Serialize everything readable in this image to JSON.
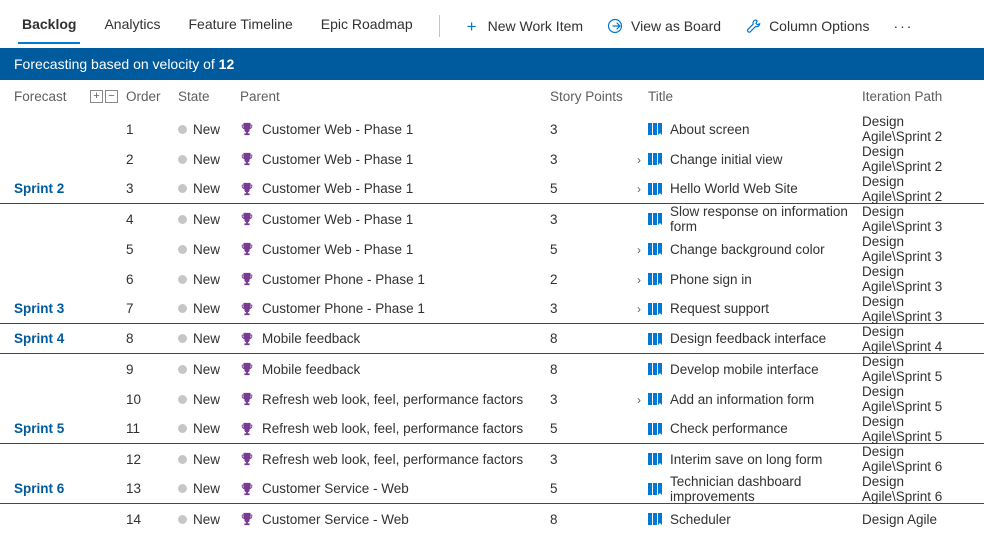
{
  "tabs": {
    "backlog": "Backlog",
    "analytics": "Analytics",
    "featureTimeline": "Feature Timeline",
    "epicRoadmap": "Epic Roadmap"
  },
  "commands": {
    "newWorkItem": "New Work Item",
    "viewAsBoard": "View as Board",
    "columnOptions": "Column Options"
  },
  "banner": {
    "prefix": "Forecasting based on velocity of ",
    "value": "12"
  },
  "headers": {
    "forecast": "Forecast",
    "order": "Order",
    "state": "State",
    "parent": "Parent",
    "storyPoints": "Story Points",
    "title": "Title",
    "iterationPath": "Iteration Path"
  },
  "rows": [
    {
      "forecast": "",
      "order": "1",
      "state": "New",
      "parent": "Customer Web - Phase 1",
      "points": "3",
      "expand": false,
      "title": "About screen",
      "iter": "Design Agile\\Sprint 2",
      "divider": false
    },
    {
      "forecast": "",
      "order": "2",
      "state": "New",
      "parent": "Customer Web - Phase 1",
      "points": "3",
      "expand": true,
      "title": "Change initial view",
      "iter": "Design Agile\\Sprint 2",
      "divider": false
    },
    {
      "forecast": "Sprint 2",
      "order": "3",
      "state": "New",
      "parent": "Customer Web - Phase 1",
      "points": "5",
      "expand": true,
      "title": "Hello World Web Site",
      "iter": "Design Agile\\Sprint 2",
      "divider": true
    },
    {
      "forecast": "",
      "order": "4",
      "state": "New",
      "parent": "Customer Web - Phase 1",
      "points": "3",
      "expand": false,
      "title": "Slow response on information form",
      "iter": "Design Agile\\Sprint 3",
      "divider": false
    },
    {
      "forecast": "",
      "order": "5",
      "state": "New",
      "parent": "Customer Web - Phase 1",
      "points": "5",
      "expand": true,
      "title": "Change background color",
      "iter": "Design Agile\\Sprint 3",
      "divider": false
    },
    {
      "forecast": "",
      "order": "6",
      "state": "New",
      "parent": "Customer Phone - Phase 1",
      "points": "2",
      "expand": true,
      "title": "Phone sign in",
      "iter": "Design Agile\\Sprint 3",
      "divider": false
    },
    {
      "forecast": "Sprint 3",
      "order": "7",
      "state": "New",
      "parent": "Customer Phone - Phase 1",
      "points": "3",
      "expand": true,
      "title": "Request support",
      "iter": "Design Agile\\Sprint 3",
      "divider": true
    },
    {
      "forecast": "Sprint 4",
      "order": "8",
      "state": "New",
      "parent": "Mobile feedback",
      "points": "8",
      "expand": false,
      "title": "Design feedback interface",
      "iter": "Design Agile\\Sprint 4",
      "divider": true
    },
    {
      "forecast": "",
      "order": "9",
      "state": "New",
      "parent": "Mobile feedback",
      "points": "8",
      "expand": false,
      "title": "Develop mobile interface",
      "iter": "Design Agile\\Sprint 5",
      "divider": false
    },
    {
      "forecast": "",
      "order": "10",
      "state": "New",
      "parent": "Refresh web look, feel, performance factors",
      "points": "3",
      "expand": true,
      "title": "Add an information form",
      "iter": "Design Agile\\Sprint 5",
      "divider": false
    },
    {
      "forecast": "Sprint 5",
      "order": "11",
      "state": "New",
      "parent": "Refresh web look, feel, performance factors",
      "points": "5",
      "expand": false,
      "title": "Check performance",
      "iter": "Design Agile\\Sprint 5",
      "divider": true
    },
    {
      "forecast": "",
      "order": "12",
      "state": "New",
      "parent": "Refresh web look, feel, performance factors",
      "points": "3",
      "expand": false,
      "title": "Interim save on long form",
      "iter": "Design Agile\\Sprint 6",
      "divider": false
    },
    {
      "forecast": "Sprint 6",
      "order": "13",
      "state": "New",
      "parent": "Customer Service - Web",
      "points": "5",
      "expand": false,
      "title": "Technician dashboard improvements",
      "iter": "Design Agile\\Sprint 6",
      "divider": true
    },
    {
      "forecast": "",
      "order": "14",
      "state": "New",
      "parent": "Customer Service - Web",
      "points": "8",
      "expand": false,
      "title": "Scheduler",
      "iter": "Design Agile",
      "divider": false
    }
  ]
}
